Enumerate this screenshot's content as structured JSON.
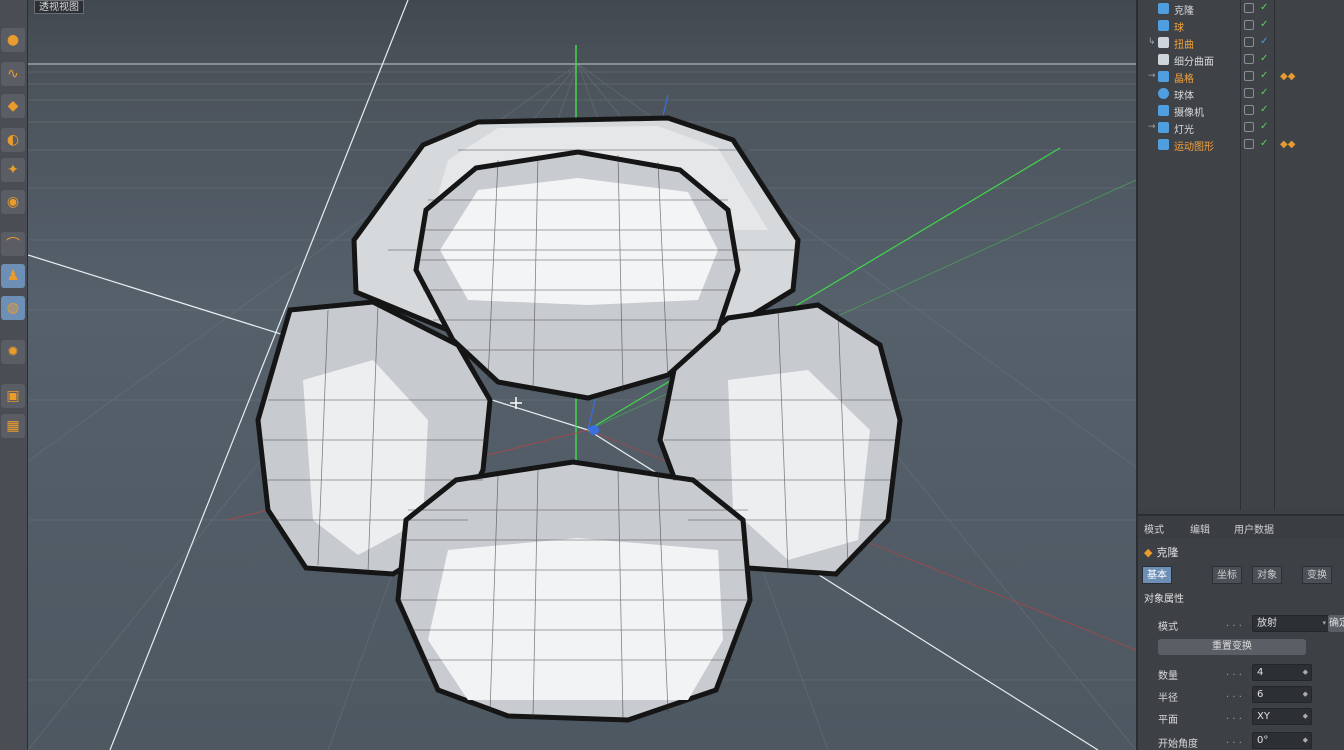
{
  "viewport": {
    "label": "透视视图"
  },
  "toolbar": {
    "tools": [
      {
        "icon": "sphere-tool-icon",
        "glyph": "●"
      },
      {
        "icon": "spline-tool-icon",
        "glyph": "∿"
      },
      {
        "icon": "nurbs-tool-icon",
        "glyph": "◆"
      },
      {
        "icon": "array-tool-icon",
        "glyph": "◐"
      },
      {
        "icon": "deformer-tool-icon",
        "glyph": "✦"
      },
      {
        "icon": "scene-tool-icon",
        "glyph": "◉"
      },
      {
        "icon": "bend-tool-icon",
        "glyph": "⌒"
      },
      {
        "icon": "figure-tool-icon",
        "glyph": "♟"
      },
      {
        "icon": "sphere-select-icon",
        "glyph": "◍"
      },
      {
        "icon": "light-tool-icon",
        "glyph": "✹"
      },
      {
        "icon": "camera-tool-icon",
        "glyph": "▣"
      },
      {
        "icon": "render-tool-icon",
        "glyph": "▦"
      }
    ]
  },
  "objects": [
    {
      "name": "克隆",
      "tree": "",
      "icon_color": "#4f9fe0",
      "orange": false
    },
    {
      "name": "球",
      "tree": "",
      "icon_color": "#4f9fe0",
      "orange": true
    },
    {
      "name": "扭曲",
      "tree": "↳",
      "icon_color": "#cfd5dc",
      "orange": true
    },
    {
      "name": "细分曲面",
      "tree": "",
      "icon_color": "#cfd5dc",
      "orange": false
    },
    {
      "name": "晶格",
      "tree": "→",
      "icon_color": "#4f9fe0",
      "orange": true
    },
    {
      "name": "球体",
      "tree": "",
      "icon_color": "#4f9fe0",
      "orange": false
    },
    {
      "name": "摄像机",
      "tree": "",
      "icon_color": "#4f9fe0",
      "orange": false
    },
    {
      "name": "灯光",
      "tree": "→",
      "icon_color": "#4f9fe0",
      "orange": false
    },
    {
      "name": "运动图形",
      "tree": "",
      "icon_color": "#4f9fe0",
      "orange": true
    }
  ],
  "attributes": {
    "menu": [
      "模式",
      "编辑",
      "用户数据"
    ],
    "title": "克隆",
    "tabs": [
      "基本",
      "坐标",
      "对象",
      "变换"
    ],
    "section": "对象属性",
    "mode_label": "模式",
    "mode_value": "放射",
    "mode_button": "确定",
    "action_button": "重置变换",
    "rows": [
      {
        "label": "数量",
        "value": "4"
      },
      {
        "label": "半径",
        "value": "6"
      },
      {
        "label": "平面",
        "value": "XY"
      },
      {
        "label": "开始角度",
        "value": "0°"
      }
    ]
  }
}
